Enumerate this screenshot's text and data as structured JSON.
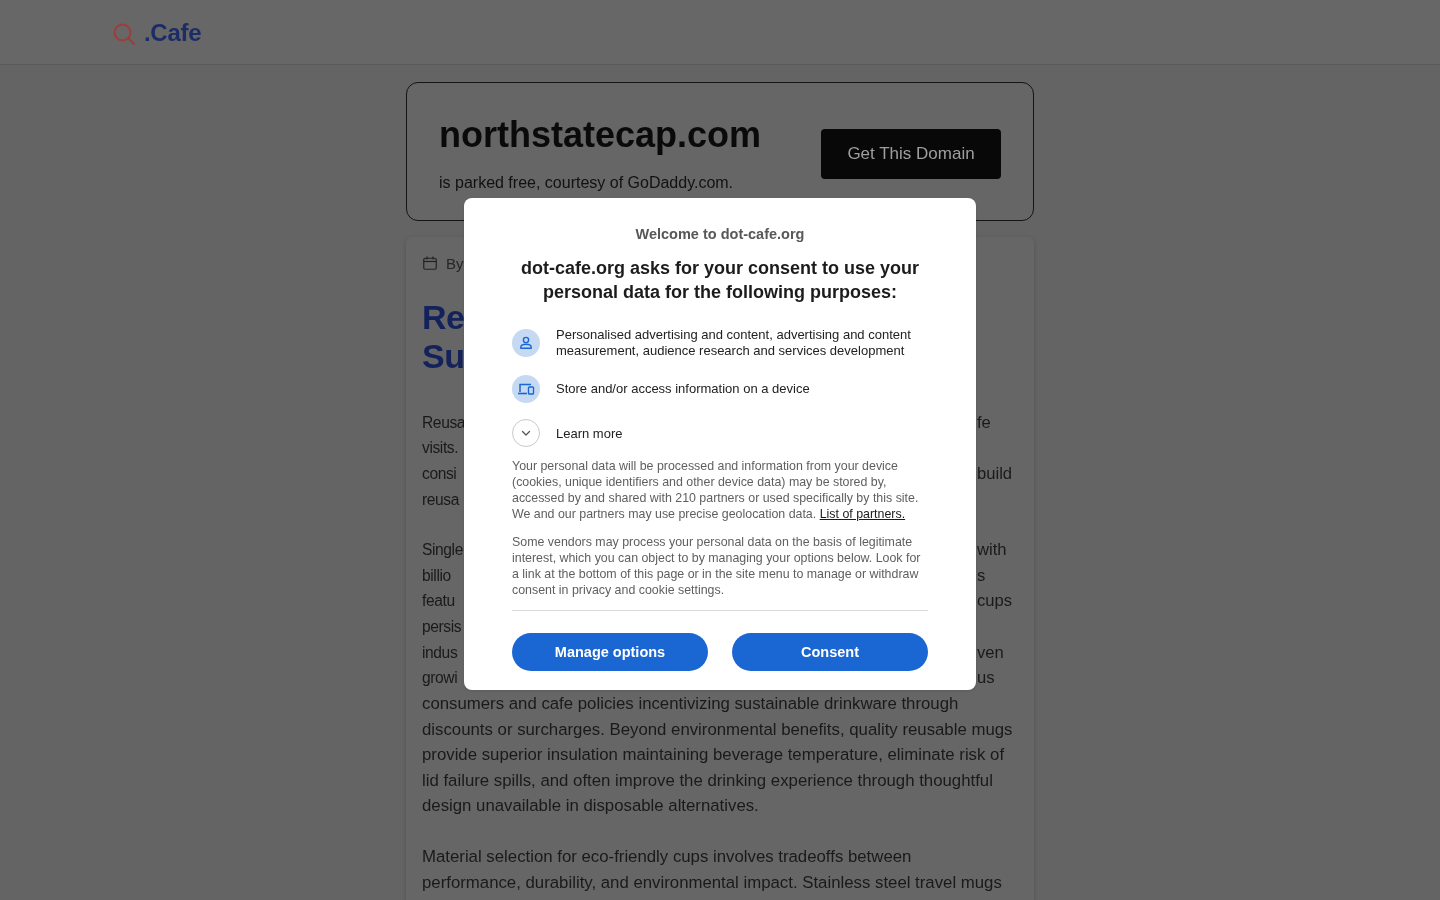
{
  "header": {
    "logo_text": ".Cafe"
  },
  "domain_card": {
    "domain": "northstatecap.com",
    "subtitle": "is parked free, courtesy of GoDaddy.com.",
    "button": "Get This Domain"
  },
  "article": {
    "byline": "By",
    "title_fragments": [
      "Re",
      "Su"
    ],
    "paragraphs": [
      {
        "covered_lines": [
          {
            "left": "Reusa",
            "right": "fe"
          },
          {
            "left": "visits."
          },
          {
            "left": "consi",
            "right": "build"
          },
          {
            "left": "reusa"
          }
        ]
      },
      {
        "covered_lines": [
          {
            "left": "Single",
            "right": "with"
          },
          {
            "left": "billio",
            "right": "s"
          },
          {
            "left": "featu",
            "right": "cups"
          },
          {
            "left": "persis"
          },
          {
            "left": "indus",
            "right": "ven"
          },
          {
            "left": "growi",
            "right": "us"
          }
        ],
        "lines": [
          "consumers and cafe policies incentivizing sustainable drinkware through",
          "discounts or surcharges. Beyond environmental benefits, quality reusable mugs",
          "provide superior insulation maintaining beverage temperature, eliminate risk of",
          "lid failure spills, and often improve the drinking experience through thoughtful",
          "design unavailable in disposable alternatives."
        ]
      },
      {
        "lines": [
          "Material selection for eco-friendly cups involves tradeoffs between",
          "performance, durability, and environmental impact. Stainless steel travel mugs"
        ]
      }
    ]
  },
  "consent_dialog": {
    "welcome": "Welcome to dot-cafe.org",
    "heading": "dot-cafe.org asks for your consent to use your personal data for the following purposes:",
    "purposes": [
      "Personalised advertising and content, advertising and content measurement, audience research and services development",
      "Store and/or access information on a device"
    ],
    "learn_more": {
      "label": "Learn more",
      "expanded": false
    },
    "notices": [
      {
        "text": "Your personal data will be processed and information from your device (cookies, unique identifiers and other device data) may be stored by, accessed by and shared with 210 partners or used specifically by this site. We and our partners may use precise geolocation data.",
        "link": "List of partners."
      },
      {
        "text": "Some vendors may process your personal data on the basis of legitimate interest, which you can object to by managing your options below. Look for a link at the bottom of this page or in the site menu to manage or withdraw consent in privacy and cookie settings."
      }
    ],
    "buttons": [
      "Manage options",
      "Consent"
    ]
  }
}
